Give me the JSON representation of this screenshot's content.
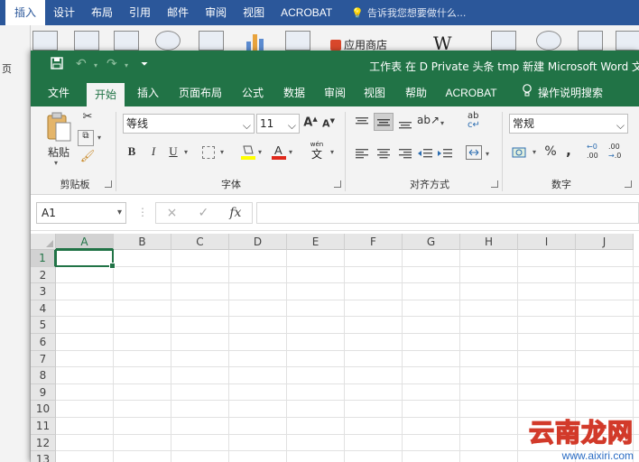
{
  "word": {
    "tabs": [
      "插入",
      "设计",
      "布局",
      "引用",
      "邮件",
      "审阅",
      "视图",
      "ACROBAT"
    ],
    "active_tab": "插入",
    "tell_me": "告诉我您想要做什么...",
    "ribbon_items": {
      "app_store": "应用商店",
      "wiki": "W"
    },
    "left_text": "页",
    "accent": "#2b579a"
  },
  "excel": {
    "accent": "#217346",
    "title": "工作表 在 D  Private 头条 tmp 新建 Microsoft Word 文",
    "qat": {
      "save": "save-icon",
      "undo": "undo-icon",
      "redo": "redo-icon",
      "customize": "customize-icon"
    },
    "tabs": [
      "文件",
      "开始",
      "插入",
      "页面布局",
      "公式",
      "数据",
      "审阅",
      "视图",
      "帮助",
      "ACROBAT"
    ],
    "active_tab": "开始",
    "tell_me": "操作说明搜索",
    "ribbon": {
      "clipboard": {
        "label": "剪贴板",
        "paste": "粘贴"
      },
      "font": {
        "label": "字体",
        "name": "等线",
        "size": "11",
        "bold": "B",
        "italic": "I",
        "underline": "U",
        "grow": "A",
        "shrink": "A",
        "phonetic_top": "wén",
        "phonetic_bottom": "文"
      },
      "alignment": {
        "label": "对齐方式",
        "wrap": "ab"
      },
      "number": {
        "label": "数字",
        "format": "常规",
        "percent": "%",
        "comma": ",",
        "inc": ".00",
        "dec": ".0"
      }
    },
    "formula_bar": {
      "name_box": "A1",
      "cancel": "×",
      "enter": "✓",
      "fx": "fx",
      "value": ""
    },
    "columns": [
      "A",
      "B",
      "C",
      "D",
      "E",
      "F",
      "G",
      "H",
      "I",
      "J"
    ],
    "rows": [
      "1",
      "2",
      "3",
      "4",
      "5",
      "6",
      "7",
      "8",
      "9",
      "10",
      "11",
      "12",
      "13"
    ],
    "selected_cell": "A1"
  },
  "watermark": {
    "text": "云南龙网",
    "url": "www.aixiri.com"
  }
}
